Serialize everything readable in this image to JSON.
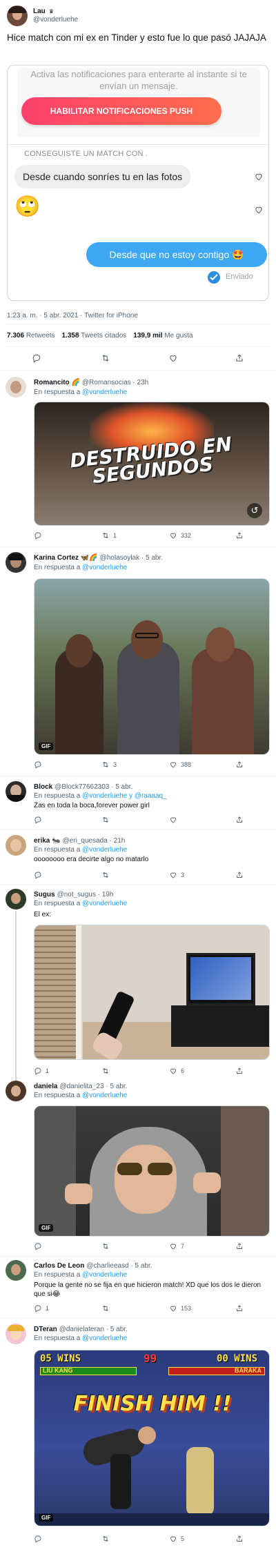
{
  "tweet": {
    "author_name": "Lau",
    "author_badge": "♛",
    "author_handle": "@vonderluehe",
    "text": "Hice match con mi ex en Tinder y esto fue lo que pasó JAJAJA",
    "timestamp": "1:23 a. m. · 5 abr. 2021 · Twitter for iPhone",
    "stats": {
      "retweets_value": "7.306",
      "retweets_label": "Retweets",
      "quotes_value": "1.358",
      "quotes_label": "Tweets citados",
      "likes_value": "139,9 mil",
      "likes_label": "Me gusta"
    },
    "screenshot": {
      "notif_text": "Activa las notificaciones para enterarte al instante si te envían un mensaje.",
      "push_button": "HABILITAR NOTIFICACIONES PUSH",
      "match_label": "CONSEGUISTE UN MATCH CON .",
      "msg1": "Desde cuando sonríes tu en las fotos",
      "emoji1": "🙄",
      "msg2": "Desde que no estoy contigo 🤩",
      "sent_label": "Enviado"
    }
  },
  "replies": [
    {
      "name": "Romancito 🌈",
      "handle": "@Romansocias · 23h",
      "in_reply_prefix": "En respuesta a ",
      "in_reply_to": "@vonderluehe",
      "text": "",
      "media_text": "DESTRUIDO EN SEGUNDOS",
      "counts": {
        "reply": "",
        "retweet": "1",
        "like": "332"
      }
    },
    {
      "name": "Karina Cortez 🦋🌈",
      "handle": "@holasoylak · 5 abr.",
      "in_reply_prefix": "En respuesta a ",
      "in_reply_to": "@vonderluehe",
      "text": "",
      "media_badge": "GIF",
      "counts": {
        "reply": "",
        "retweet": "3",
        "like": "388"
      }
    },
    {
      "name": "Block",
      "handle": "@Block77662303 · 5 abr.",
      "in_reply_prefix": "En respuesta a ",
      "in_reply_to": "@vonderluehe y @raaaaq_",
      "text": "Zas en toda la boca,forever power girl",
      "counts": {
        "reply": "",
        "retweet": "",
        "like": ""
      }
    },
    {
      "name": "erika 🐜",
      "handle": "@eri_quesada · 21h",
      "in_reply_prefix": "En respuesta a ",
      "in_reply_to": "@vonderluehe",
      "text": "oooooooo era decirte algo no matarlo",
      "counts": {
        "reply": "",
        "retweet": "",
        "like": "3"
      }
    },
    {
      "name": "Sugus",
      "handle": "@not_sugus · 19h",
      "in_reply_prefix": "En respuesta a ",
      "in_reply_to": "@vonderluehe",
      "text": "El ex:",
      "counts": {
        "reply": "1",
        "retweet": "",
        "like": "6"
      }
    },
    {
      "name": "daniela",
      "handle": "@danielita_23 · 5 abr.",
      "in_reply_prefix": "En respuesta a ",
      "in_reply_to": "@vonderluehe",
      "text": "",
      "media_badge": "GIF",
      "counts": {
        "reply": "",
        "retweet": "",
        "like": "7"
      }
    },
    {
      "name": "Carlos De Leon",
      "handle": "@charlieeasd · 5 abr.",
      "in_reply_prefix": "En respuesta a ",
      "in_reply_to": "@vonderluehe",
      "text": "Porque la gente no se fija en que hicieron match! XD que los dos le dieron que si😂",
      "counts": {
        "reply": "1",
        "retweet": "",
        "like": "153"
      }
    },
    {
      "name": "DTeran",
      "handle": "@danielateran · 5 abr.",
      "in_reply_prefix": "En respuesta a ",
      "in_reply_to": "@vonderluehe",
      "text": "",
      "media_badge": "GIF",
      "game": {
        "wins_left": "05 WINS",
        "timer": "99",
        "wins_right": "00 WINS",
        "p1": "LIU KANG",
        "p2": "BARAKA",
        "banner": "FINISH HIM !!"
      },
      "counts": {
        "reply": "",
        "retweet": "",
        "like": "5"
      }
    }
  ],
  "colors": {
    "accent": "#1d9bf0",
    "tinder": "#fd5068",
    "bubble_blue": "#3ea8f5"
  }
}
